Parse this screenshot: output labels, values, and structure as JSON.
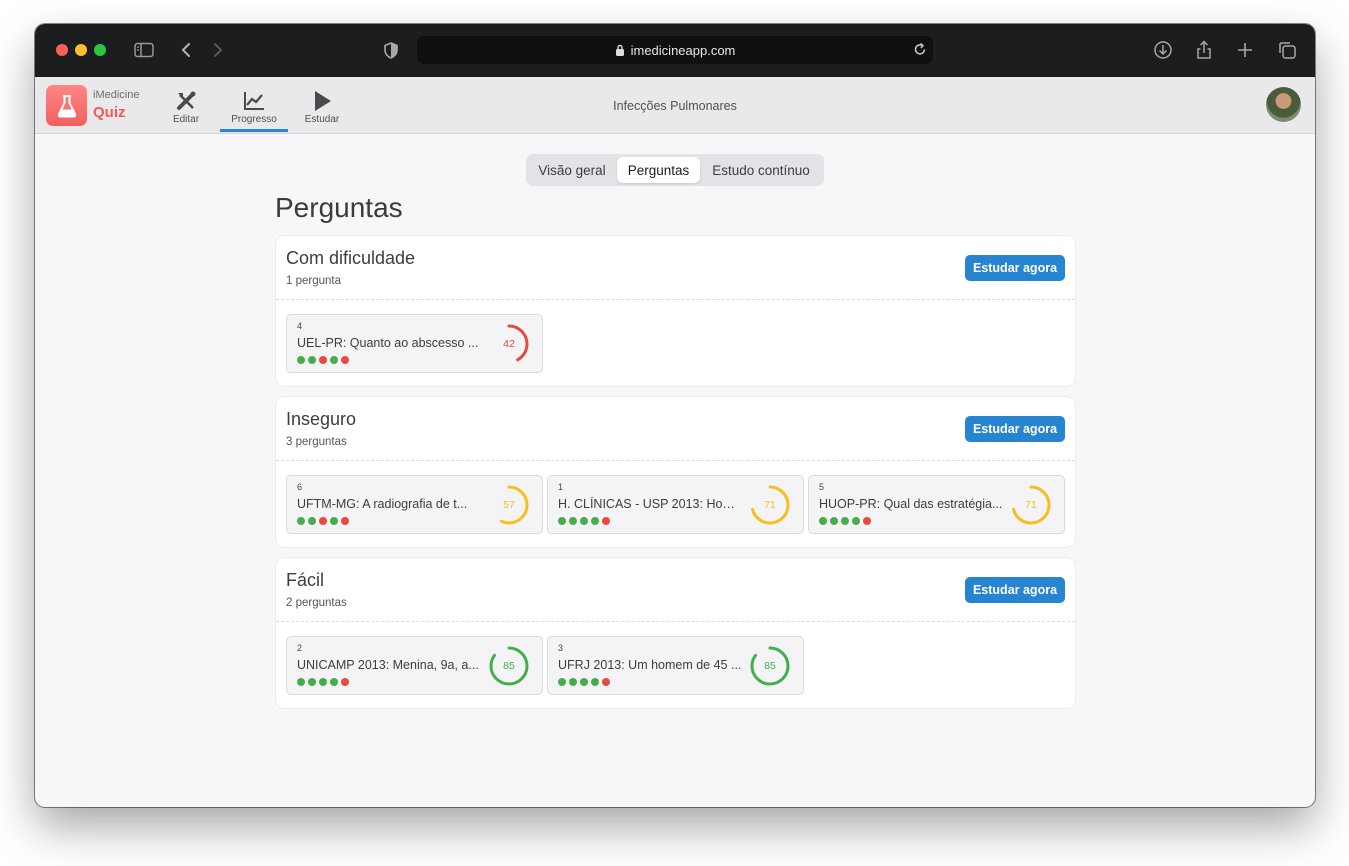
{
  "browser": {
    "url": "imedicineapp.com"
  },
  "app": {
    "brand_top": "iMedicine",
    "brand_bottom": "Quiz",
    "title": "Infecções Pulmonares",
    "nav": [
      {
        "label": "Editar",
        "icon": "edit-tools-icon"
      },
      {
        "label": "Progresso",
        "icon": "chart-line-icon",
        "active": true
      },
      {
        "label": "Estudar",
        "icon": "play-icon"
      }
    ]
  },
  "tabs": [
    {
      "label": "Visão geral",
      "active": false
    },
    {
      "label": "Perguntas",
      "active": true
    },
    {
      "label": "Estudo contínuo",
      "active": false
    }
  ],
  "page_title": "Perguntas",
  "colors": {
    "accent": "#2684d0",
    "red": "#e84a3c",
    "yellow": "#f6bf1c",
    "green": "#46ad4d",
    "brand": "#ef5b5b"
  },
  "sections": [
    {
      "title": "Com dificuldade",
      "count": "1 pergunta",
      "button": "Estudar agora",
      "questions": [
        {
          "num": "4",
          "text": "UEL-PR: Quanto ao abscesso ...",
          "score": 42,
          "score_label": "42",
          "color": "#e84a3c",
          "dots": [
            "g",
            "g",
            "r",
            "g",
            "r"
          ]
        }
      ]
    },
    {
      "title": "Inseguro",
      "count": "3 perguntas",
      "button": "Estudar agora",
      "questions": [
        {
          "num": "6",
          "text": "UFTM-MG: A radiografia de t...",
          "score": 57,
          "score_label": "57",
          "color": "#f6bf1c",
          "dots": [
            "g",
            "g",
            "r",
            "g",
            "r"
          ]
        },
        {
          "num": "1",
          "text": "H. CLÍNICAS - USP 2013: Hom...",
          "score": 71,
          "score_label": "71",
          "color": "#f6bf1c",
          "dots": [
            "g",
            "g",
            "g",
            "g",
            "r"
          ]
        },
        {
          "num": "5",
          "text": "HUOP-PR: Qual das estratégia...",
          "score": 71,
          "score_label": "71",
          "color": "#f6bf1c",
          "dots": [
            "g",
            "g",
            "g",
            "g",
            "r"
          ]
        }
      ]
    },
    {
      "title": "Fácil",
      "count": "2 perguntas",
      "button": "Estudar agora",
      "questions": [
        {
          "num": "2",
          "text": "UNICAMP 2013: Menina, 9a, a...",
          "score": 85,
          "score_label": "85",
          "color": "#46ad4d",
          "dots": [
            "g",
            "g",
            "g",
            "g",
            "r"
          ]
        },
        {
          "num": "3",
          "text": "UFRJ 2013: Um homem de 45 ...",
          "score": 85,
          "score_label": "85",
          "color": "#46ad4d",
          "dots": [
            "g",
            "g",
            "g",
            "g",
            "r"
          ]
        }
      ]
    }
  ]
}
